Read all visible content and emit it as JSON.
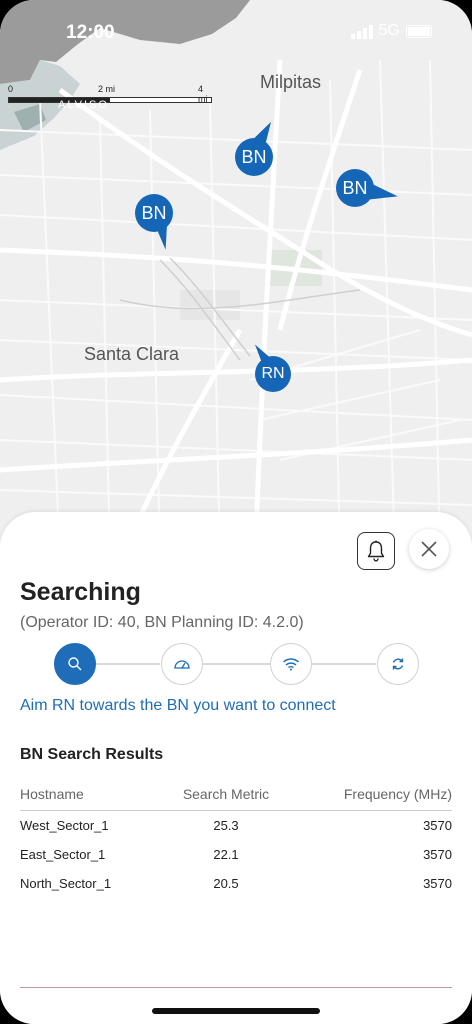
{
  "status": {
    "time": "12:00",
    "network": "5G"
  },
  "map": {
    "scale": {
      "labels": [
        "0",
        "2 mi",
        "4 mi"
      ]
    },
    "places": [
      "Milpitas",
      "ALVISO",
      "Santa Clara"
    ],
    "pins": [
      "BN",
      "BN",
      "BN",
      "RN"
    ],
    "pin_color": "#1566b7"
  },
  "sheet": {
    "title": "Searching",
    "subtitle": "(Operator ID: 40, BN Planning ID: 4.2.0)",
    "steps": [
      "search-icon",
      "speedometer-icon",
      "wifi-icon",
      "sync-icon"
    ],
    "active_step": 0,
    "instruction": "Aim RN towards the BN you want to connect",
    "results_title": "BN Search Results",
    "columns": [
      "Hostname",
      "Search Metric",
      "Frequency (MHz)"
    ],
    "rows": [
      {
        "hostname": "West_Sector_1",
        "metric": "25.3",
        "frequency": "3570"
      },
      {
        "hostname": "East_Sector_1",
        "metric": "22.1",
        "frequency": "3570"
      },
      {
        "hostname": "North_Sector_1",
        "metric": "20.5",
        "frequency": "3570"
      }
    ],
    "accent_color": "#1f6db8"
  }
}
